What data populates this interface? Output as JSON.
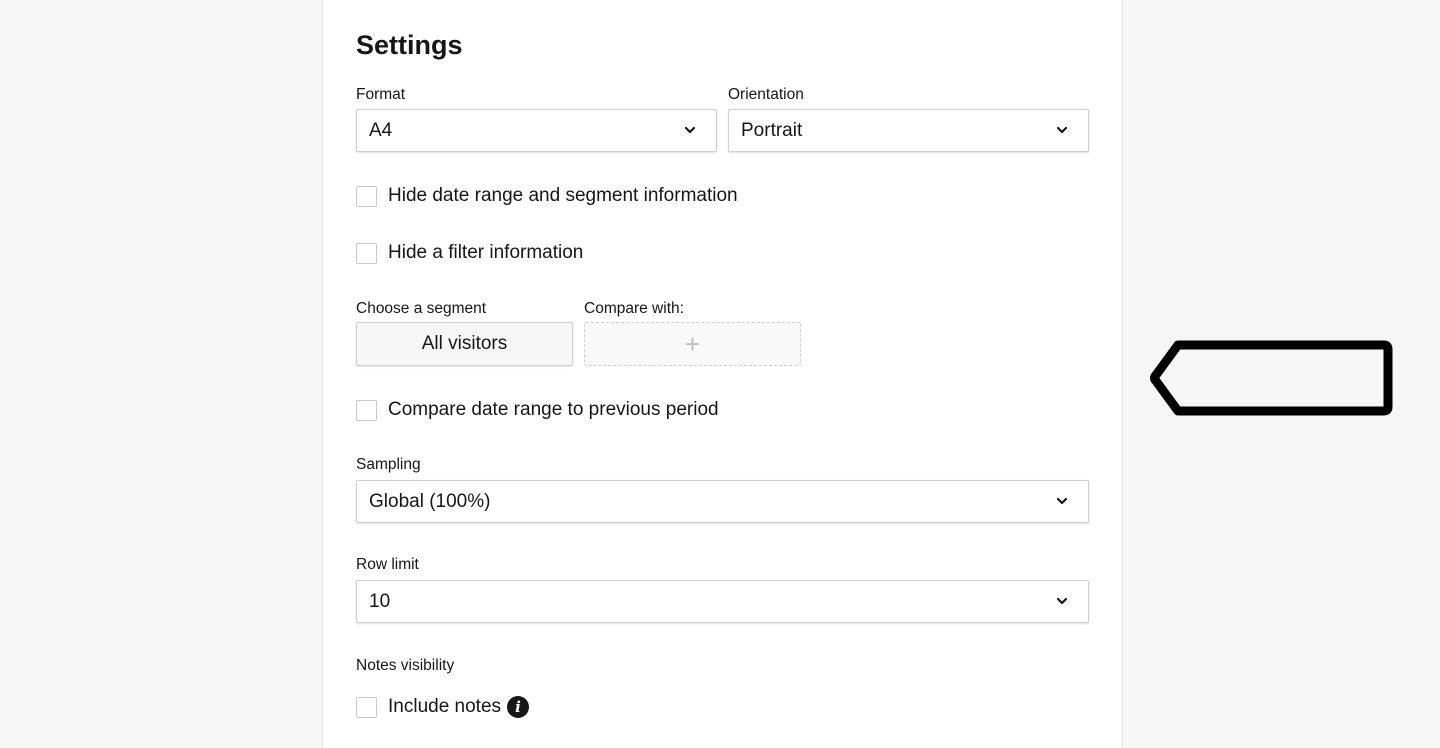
{
  "settings": {
    "title": "Settings",
    "format": {
      "label": "Format",
      "value": "A4"
    },
    "orientation": {
      "label": "Orientation",
      "value": "Portrait"
    },
    "hide_date_range": {
      "label": "Hide date range and segment information",
      "checked": false
    },
    "hide_filter": {
      "label": "Hide a filter information",
      "checked": false
    },
    "segment": {
      "label": "Choose a segment",
      "value": "All visitors"
    },
    "compare": {
      "label": "Compare with:",
      "add_symbol": "+"
    },
    "compare_date_range": {
      "label": "Compare date range to previous period",
      "checked": false
    },
    "sampling": {
      "label": "Sampling",
      "value": "Global (100%)"
    },
    "row_limit": {
      "label": "Row limit",
      "value": "10"
    },
    "notes_visibility": {
      "label": "Notes visibility",
      "include_notes": {
        "label": "Include notes",
        "checked": false,
        "icon": "info-icon"
      }
    }
  },
  "colors": {
    "background": "#f6f6f6",
    "panel": "#ffffff",
    "text": "#161616",
    "border": "#cfcfcf",
    "arrow": "#000000"
  }
}
